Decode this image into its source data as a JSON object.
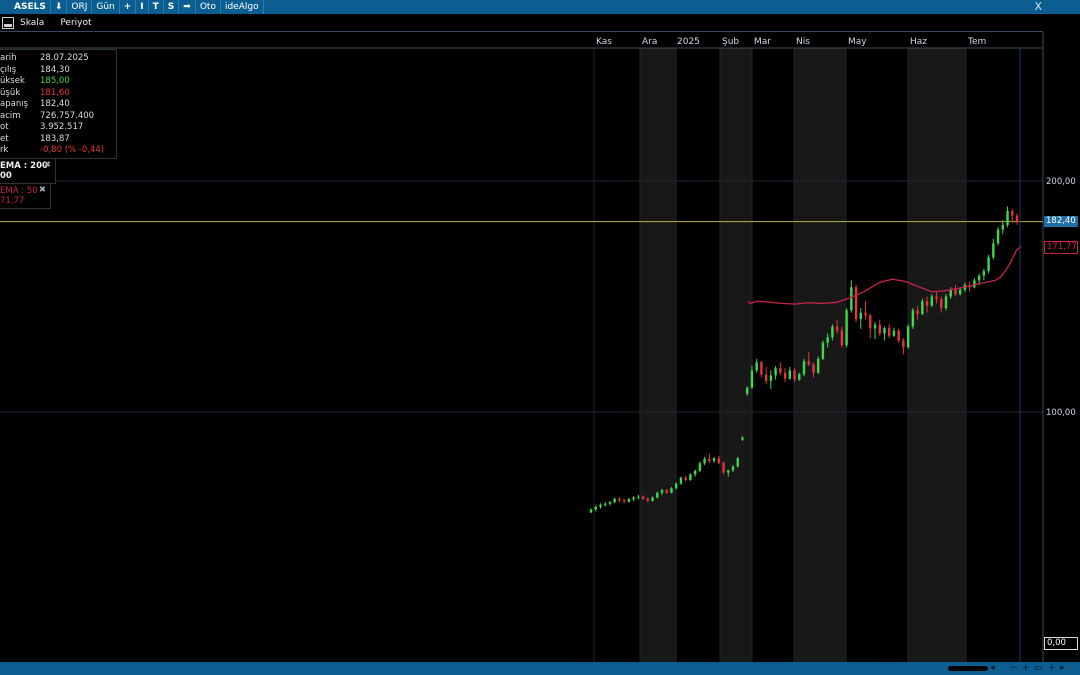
{
  "toolbar": {
    "symbol": "ASELS",
    "down_arrow": "⬇",
    "mode": "ORJ",
    "period": "Gün",
    "add": "+",
    "tool_i": "I",
    "tool_t": "T",
    "tool_s": "S",
    "right_arrow": "➡",
    "auto": "Oto",
    "idealgo": "ideAlgo",
    "close_glyph": "X"
  },
  "menu": {
    "scale": "Skala",
    "period": "Periyot"
  },
  "info": {
    "rows": [
      {
        "label": "arih",
        "value": "28.07.2025",
        "color": "#dddddd"
      },
      {
        "label": "çılış",
        "value": "184,30",
        "color": "#dddddd"
      },
      {
        "label": "üksek",
        "value": "185,00",
        "color": "#3fd84a"
      },
      {
        "label": "üşük",
        "value": "181,60",
        "color": "#e8343a"
      },
      {
        "label": "apanış",
        "value": "182,40",
        "color": "#dddddd"
      },
      {
        "label": "acim",
        "value": "726.757.400",
        "color": "#dddddd"
      },
      {
        "label": "ot",
        "value": "3.952.517",
        "color": "#dddddd"
      },
      {
        "label": "et",
        "value": "183,87",
        "color": "#dddddd"
      },
      {
        "label": "rk",
        "value": "-0,80 (% -0,44)",
        "color": "#e8343a"
      }
    ]
  },
  "ema200": {
    "label": "EMA : 200",
    "value": "00",
    "close": "✖"
  },
  "ema50": {
    "label": "EMA : 50",
    "value": "71,77",
    "close": "✖"
  },
  "price_tags": {
    "last": "182,40",
    "ema": "171,77",
    "zero": "0,00"
  },
  "colors": {
    "up": "#3fd84a",
    "down": "#e8343a",
    "ema": "#c8234a",
    "last_line": "#b8b23a",
    "accent": "#0b5e8f"
  },
  "bottom": {
    "minus": "−",
    "plus": "+",
    "fit": "▭",
    "plus2": "+",
    "left": "◂",
    "right": "▸"
  },
  "chart_data": {
    "type": "candlestick",
    "x_ticks": [
      "Kas",
      "Ara",
      "2025",
      "Şub",
      "Mar",
      "Nis",
      "May",
      "Haz",
      "Tem"
    ],
    "y_ticks": [
      "200,00",
      "100,00",
      "0,00"
    ],
    "ylim": [
      0,
      200
    ],
    "candles": [
      [
        56.5,
        58.2,
        56.2,
        57.8
      ],
      [
        57.8,
        59.5,
        57.0,
        59.0
      ],
      [
        59.0,
        60.5,
        58.2,
        59.8
      ],
      [
        59.8,
        61.0,
        59.0,
        60.3
      ],
      [
        60.3,
        61.5,
        59.5,
        61.0
      ],
      [
        61.0,
        63.0,
        60.5,
        62.4
      ],
      [
        62.4,
        63.2,
        61.0,
        61.7
      ],
      [
        61.7,
        62.5,
        60.5,
        61.1
      ],
      [
        61.1,
        62.8,
        60.8,
        62.3
      ],
      [
        62.3,
        63.6,
        61.4,
        63.0
      ],
      [
        63.0,
        64.2,
        62.1,
        63.4
      ],
      [
        63.4,
        63.9,
        62.0,
        62.4
      ],
      [
        62.4,
        63.1,
        61.0,
        61.5
      ],
      [
        61.5,
        63.4,
        61.2,
        63.0
      ],
      [
        63.0,
        65.5,
        62.5,
        65.0
      ],
      [
        65.0,
        66.8,
        64.0,
        66.2
      ],
      [
        66.2,
        66.7,
        64.5,
        65.0
      ],
      [
        65.0,
        67.5,
        64.8,
        67.0
      ],
      [
        67.0,
        69.5,
        66.5,
        69.0
      ],
      [
        69.0,
        72.0,
        68.5,
        71.6
      ],
      [
        71.6,
        72.5,
        70.0,
        70.6
      ],
      [
        70.6,
        73.5,
        70.2,
        73.0
      ],
      [
        73.0,
        75.0,
        72.0,
        74.6
      ],
      [
        74.6,
        78.5,
        74.0,
        77.8
      ],
      [
        77.8,
        80.5,
        77.0,
        79.8
      ],
      [
        79.8,
        82.0,
        78.0,
        78.8
      ],
      [
        78.8,
        80.6,
        78.0,
        80.0
      ],
      [
        80.0,
        81.0,
        77.5,
        78.0
      ],
      [
        78.0,
        78.5,
        73.0,
        73.8
      ],
      [
        73.8,
        75.0,
        72.0,
        74.8
      ],
      [
        74.8,
        77.0,
        74.0,
        76.4
      ],
      [
        76.4,
        80.5,
        76.0,
        80.0
      ],
      [
        88.0,
        89.5,
        87.5,
        89.0
      ],
      [
        108.0,
        111.0,
        107.0,
        110.5
      ],
      [
        110.5,
        120.0,
        110.0,
        118.0
      ],
      [
        118.0,
        123.0,
        117.0,
        121.5
      ],
      [
        121.5,
        122.0,
        115.0,
        116.2
      ],
      [
        116.2,
        119.5,
        112.0,
        113.5
      ],
      [
        113.5,
        118.0,
        110.0,
        115.8
      ],
      [
        115.8,
        120.0,
        114.0,
        119.0
      ],
      [
        119.0,
        121.5,
        116.0,
        117.0
      ],
      [
        117.0,
        119.0,
        113.0,
        114.4
      ],
      [
        114.4,
        119.5,
        114.0,
        118.0
      ],
      [
        118.0,
        119.0,
        113.0,
        114.0
      ],
      [
        114.0,
        117.0,
        113.5,
        116.4
      ],
      [
        116.4,
        123.0,
        115.5,
        122.0
      ],
      [
        122.0,
        126.0,
        120.0,
        120.6
      ],
      [
        120.6,
        121.5,
        115.0,
        117.0
      ],
      [
        117.0,
        124.0,
        116.5,
        123.0
      ],
      [
        123.0,
        131.0,
        122.5,
        130.0
      ],
      [
        130.0,
        134.0,
        128.0,
        132.3
      ],
      [
        132.3,
        138.0,
        131.0,
        137.0
      ],
      [
        137.0,
        140.0,
        134.0,
        135.3
      ],
      [
        135.3,
        137.0,
        128.0,
        129.0
      ],
      [
        129.0,
        145.0,
        128.0,
        144.0
      ],
      [
        144.0,
        157.0,
        143.0,
        154.0
      ],
      [
        154.0,
        155.0,
        139.0,
        140.2
      ],
      [
        140.2,
        145.0,
        136.0,
        143.0
      ],
      [
        143.0,
        148.0,
        140.0,
        141.8
      ],
      [
        141.8,
        142.5,
        132.0,
        136.2
      ],
      [
        136.2,
        139.0,
        131.5,
        137.8
      ],
      [
        137.8,
        140.0,
        133.0,
        134.0
      ],
      [
        134.0,
        137.0,
        131.0,
        136.4
      ],
      [
        136.4,
        138.0,
        132.0,
        133.0
      ],
      [
        133.0,
        136.5,
        132.5,
        135.2
      ],
      [
        135.2,
        136.0,
        130.0,
        131.0
      ],
      [
        131.0,
        132.0,
        125.0,
        128.0
      ],
      [
        128.0,
        138.0,
        127.5,
        137.0
      ],
      [
        137.0,
        145.0,
        136.0,
        144.0
      ],
      [
        144.0,
        146.0,
        140.0,
        142.4
      ],
      [
        142.4,
        149.0,
        142.0,
        148.0
      ],
      [
        148.0,
        150.0,
        143.0,
        146.0
      ],
      [
        146.0,
        151.0,
        145.5,
        150.0
      ],
      [
        150.0,
        152.0,
        147.0,
        149.0
      ],
      [
        149.0,
        150.0,
        143.0,
        145.0
      ],
      [
        145.0,
        151.0,
        144.0,
        150.0
      ],
      [
        150.0,
        154.0,
        149.0,
        153.0
      ],
      [
        153.0,
        155.0,
        150.0,
        151.0
      ],
      [
        151.0,
        154.0,
        150.5,
        153.0
      ],
      [
        153.0,
        156.0,
        152.0,
        155.0
      ],
      [
        155.0,
        156.5,
        152.0,
        154.0
      ],
      [
        154.0,
        158.0,
        153.5,
        157.0
      ],
      [
        157.0,
        160.0,
        155.0,
        159.0
      ],
      [
        159.0,
        162.0,
        157.0,
        161.0
      ],
      [
        161.0,
        168.0,
        160.0,
        167.0
      ],
      [
        167.0,
        175.0,
        166.0,
        173.0
      ],
      [
        173.0,
        180.0,
        172.0,
        179.0
      ],
      [
        179.0,
        183.0,
        177.0,
        181.0
      ],
      [
        181.0,
        189.0,
        180.0,
        187.0
      ],
      [
        187.0,
        188.0,
        182.0,
        185.0
      ],
      [
        185.0,
        186.0,
        181.0,
        182.4
      ]
    ],
    "ema": [
      [
        126.7,
        148.0
      ],
      [
        129.2,
        147.0
      ],
      [
        139.4,
        148.0
      ],
      [
        170.5,
        147.0
      ],
      [
        187.7,
        146.7
      ],
      [
        204.9,
        147.3
      ],
      [
        222.1,
        147.0
      ],
      [
        241.9,
        147.5
      ],
      [
        259.1,
        149.5
      ],
      [
        276.3,
        152.0
      ],
      [
        296.2,
        156.0
      ],
      [
        313.4,
        157.5
      ],
      [
        330.6,
        156.5
      ],
      [
        347.8,
        154.2
      ],
      [
        365.0,
        152.0
      ],
      [
        382.2,
        152.5
      ],
      [
        399.4,
        153.5
      ],
      [
        416.6,
        154.8
      ],
      [
        439.1,
        156.5
      ],
      [
        447.0,
        157.0
      ],
      [
        453.6,
        158.5
      ],
      [
        459.6,
        161.0
      ],
      [
        466.2,
        164.5
      ],
      [
        474.1,
        170.0
      ],
      [
        480.0,
        171.8
      ]
    ]
  }
}
